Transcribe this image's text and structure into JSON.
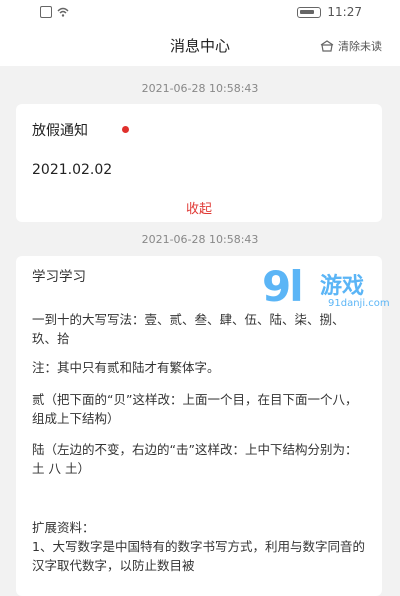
{
  "statusbar": {
    "time": "11:27"
  },
  "header": {
    "title": "消息中心",
    "clear_unread": "清除未读"
  },
  "messages": [
    {
      "time": "2021-06-28 10:58:43",
      "title": "放假通知",
      "content": "2021.02.02",
      "collapse_label": "收起"
    },
    {
      "time": "2021-06-28 10:58:43",
      "lines": [
        "学习学习",
        "一到十的大写写法：壹、贰、叁、肆、伍、陆、柒、捌、玖、拾",
        "注：其中只有贰和陆才有繁体字。",
        "贰（把下面的“贝”这样改：上面一个目，在目下面一个八，组成上下结构）",
        "陆（左边的不变，右边的“击”这样改：上中下结构分别为：土 八 土）",
        "扩展资料：",
        "1、大写数字是中国特有的数字书写方式，利用与数字同音的汉字取代数字，以防止数目被"
      ]
    }
  ],
  "watermark": {
    "logo": "9l",
    "name": "游戏",
    "url": "91danji.com"
  }
}
